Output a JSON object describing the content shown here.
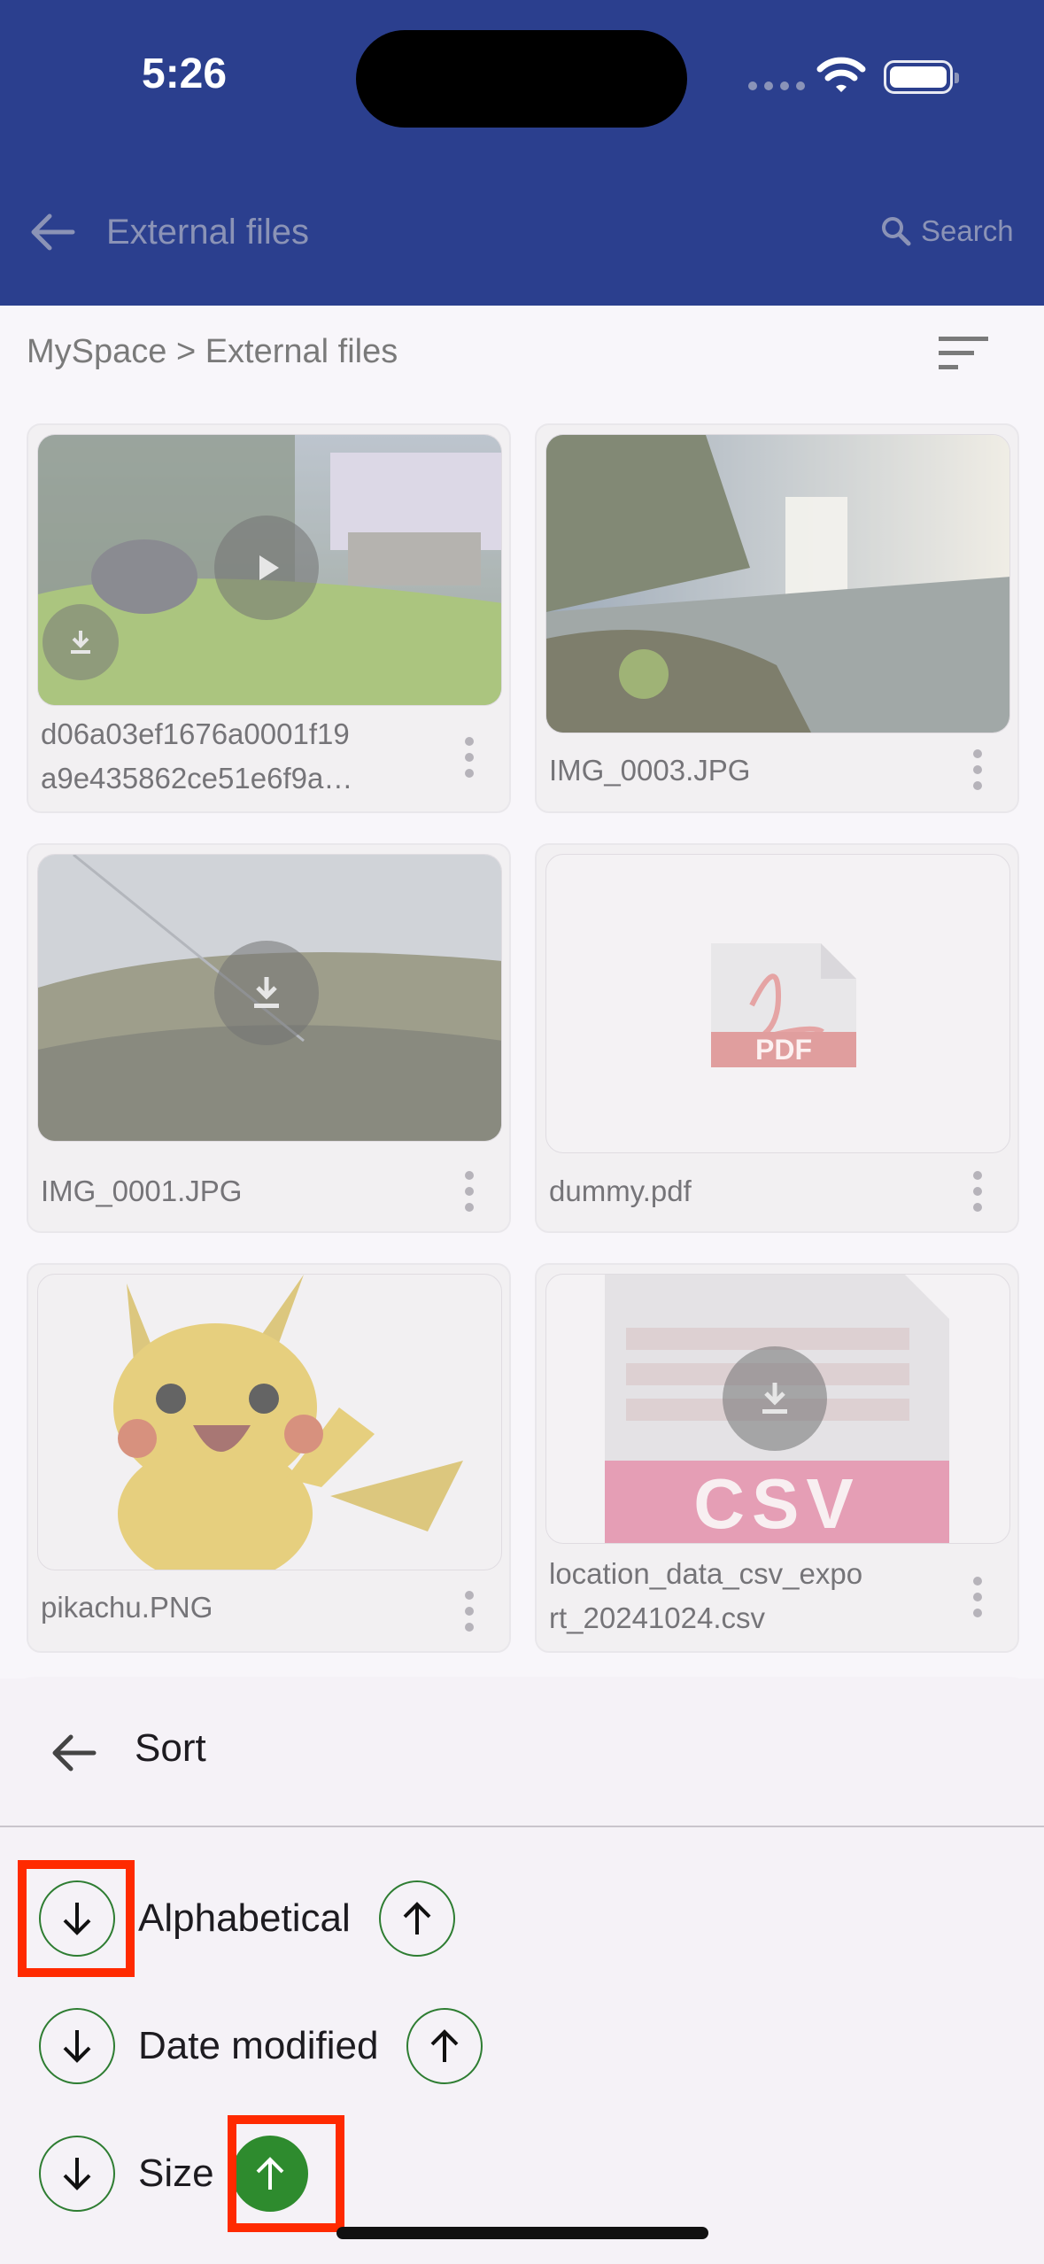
{
  "status": {
    "time": "5:26"
  },
  "appbar": {
    "title": "External files",
    "search_label": "Search"
  },
  "breadcrumb": "MySpace > External files",
  "files": [
    {
      "name_line1": "d06a03ef1676a0001f19",
      "name_line2": "a9e435862ce51e6f9a…",
      "type": "video"
    },
    {
      "name_line1": "IMG_0003.JPG",
      "type": "image"
    },
    {
      "name_line1": "IMG_0001.JPG",
      "type": "image"
    },
    {
      "name_line1": "dummy.pdf",
      "type": "pdf",
      "badge": "PDF"
    },
    {
      "name_line1": "pikachu.PNG",
      "type": "image"
    },
    {
      "name_line1": "location_data_csv_expo",
      "name_line2": "rt_20241024.csv",
      "type": "csv",
      "badge": "CSV"
    }
  ],
  "sheet": {
    "title": "Sort",
    "options": [
      {
        "label": "Alphabetical"
      },
      {
        "label": "Date modified"
      },
      {
        "label": "Size"
      }
    ]
  },
  "colors": {
    "appbar": "#2b3f8e",
    "accent_green": "#2e8b2e",
    "highlight": "#ff2a00"
  }
}
